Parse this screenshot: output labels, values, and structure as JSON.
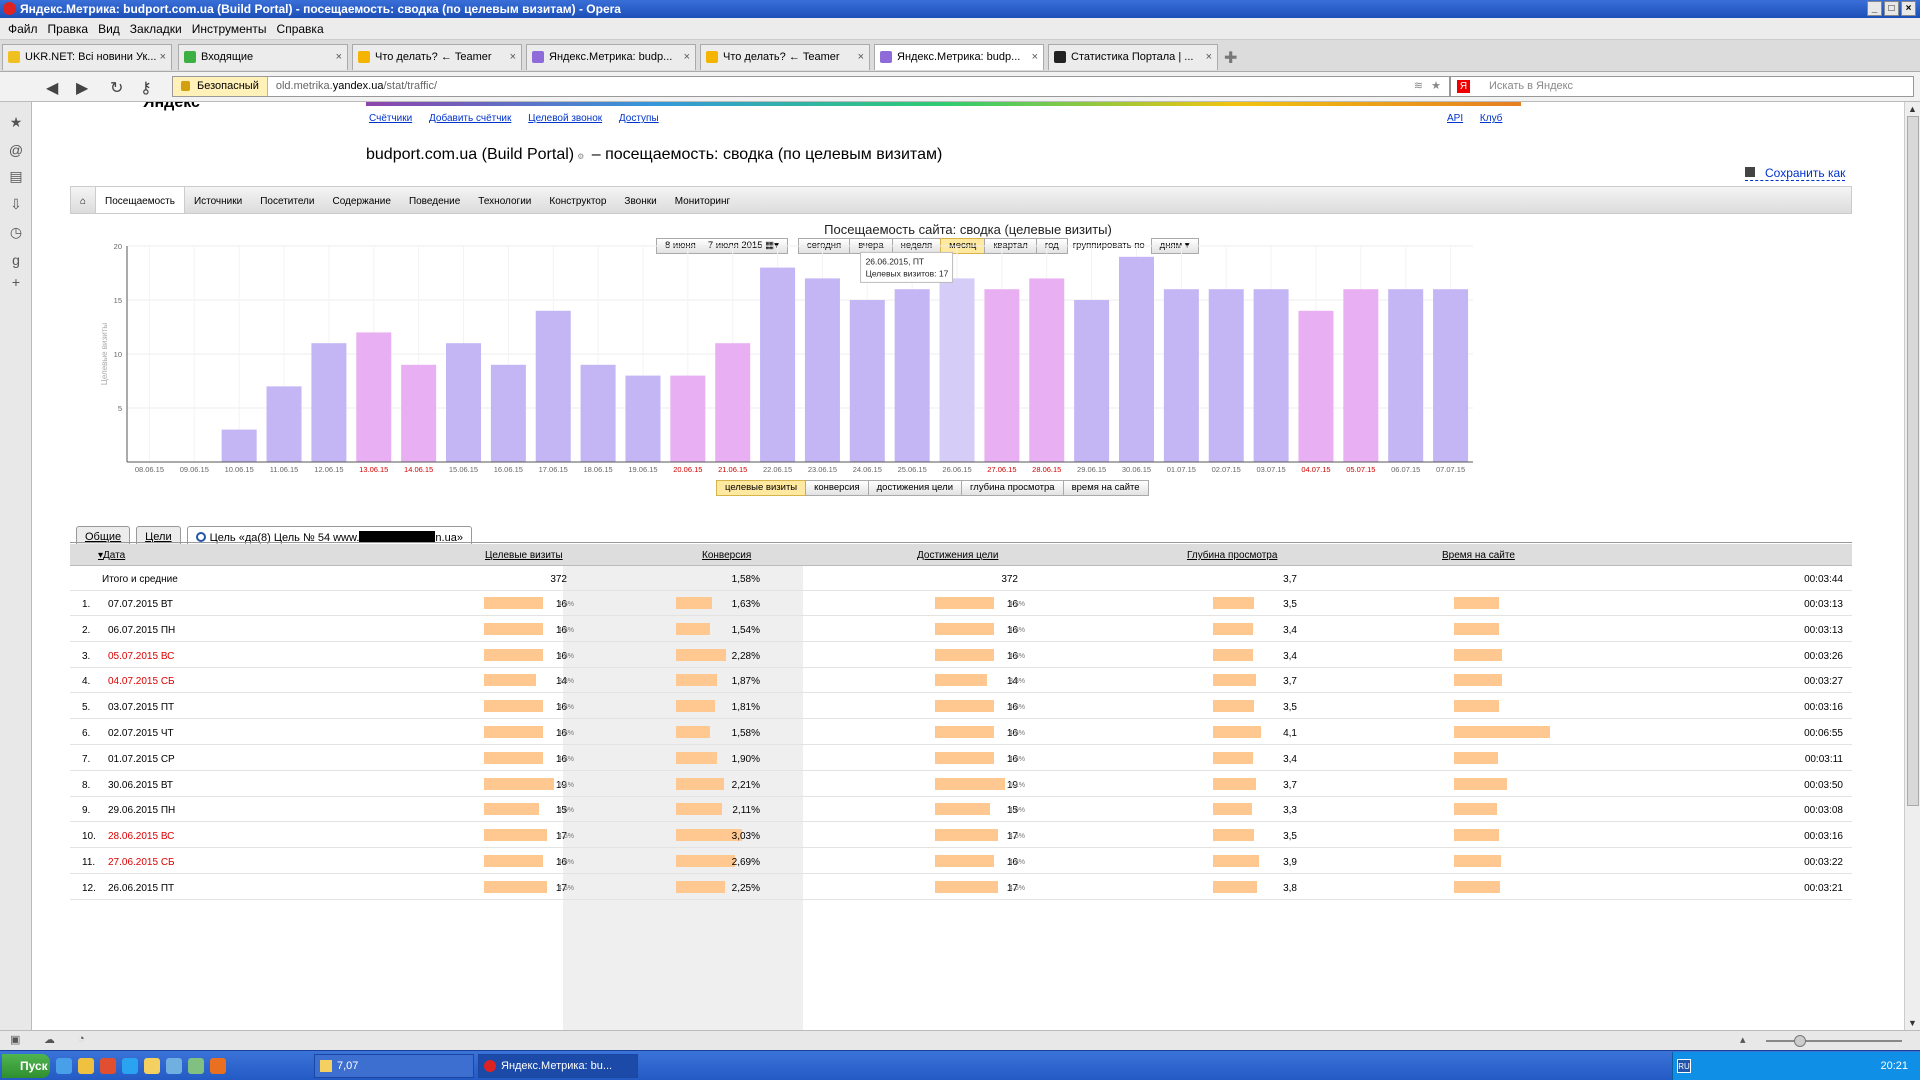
{
  "window": {
    "title": "Яндекс.Метрика: budport.com.ua (Build Portal) - посещаемость: сводка (по целевым визитам) - Opera"
  },
  "menu": [
    "Файл",
    "Правка",
    "Вид",
    "Закладки",
    "Инструменты",
    "Справка"
  ],
  "tabs": [
    {
      "label": "UKR.NET: Всі новини Ук...",
      "color": "#f0c020"
    },
    {
      "label": "Входящие",
      "color": "#3cb043"
    },
    {
      "label": "Что делать? ← Teamer",
      "color": "#f5b400"
    },
    {
      "label": "Яндекс.Метрика: budp...",
      "color": "#8e6bd8"
    },
    {
      "label": "Что делать? ← Teamer",
      "color": "#f5b400"
    },
    {
      "label": "Яндекс.Метрика: budp...",
      "color": "#8e6bd8"
    },
    {
      "label": "Статистика Портала | ...",
      "color": "#222222"
    }
  ],
  "address": {
    "secure_label": "Безопасный",
    "url_prefix": "old.metrika.",
    "url_host": "yandex.ua",
    "url_path": "/stat/traffic/",
    "search_placeholder": "Искать в Яндекс"
  },
  "site": {
    "logo": "Яндекс",
    "links": [
      "Счётчики",
      "Добавить счётчик",
      "Целевой звонок",
      "Доступы"
    ],
    "right_links": [
      "API",
      "Клуб"
    ],
    "title_site": "budport.com.ua (Build Portal)",
    "title_rest": " – посещаемость: сводка (по целевым визитам)",
    "save_label": "Сохранить как",
    "nav": [
      "Посещаемость",
      "Источники",
      "Посетители",
      "Содержание",
      "Поведение",
      "Технологии",
      "Конструктор",
      "Звонки",
      "Мониторинг"
    ],
    "date_range": "8 июня —7 июля 2015",
    "periods": [
      "сегодня",
      "вчера",
      "неделя",
      "месяц",
      "квартал",
      "год"
    ],
    "period_selected": "месяц",
    "group_label": "группировать по",
    "group_value": "дням",
    "metric_tabs": [
      "целевые визиты",
      "конверсия",
      "достижения цели",
      "глубина просмотра",
      "время на сайте"
    ],
    "metric_selected": "целевые визиты",
    "table_tabs": [
      "Общие",
      "Цели"
    ],
    "goal_tab_prefix": "Цель «да(8) Цель № 54 www.",
    "goal_tab_suffix": "n.ua»"
  },
  "chart_data": {
    "type": "bar",
    "title": "Посещаемость сайта: сводка (целевые визиты)",
    "ylabel": "Целевые визиты",
    "ylim": [
      0,
      20
    ],
    "yticks": [
      5,
      10,
      15,
      20
    ],
    "categories": [
      "08.06.15",
      "09.06.15",
      "10.06.15",
      "11.06.15",
      "12.06.15",
      "13.06.15",
      "14.06.15",
      "15.06.15",
      "16.06.15",
      "17.06.15",
      "18.06.15",
      "19.06.15",
      "20.06.15",
      "21.06.15",
      "22.06.15",
      "23.06.15",
      "24.06.15",
      "25.06.15",
      "26.06.15",
      "27.06.15",
      "28.06.15",
      "29.06.15",
      "30.06.15",
      "01.07.15",
      "02.07.15",
      "03.07.15",
      "04.07.15",
      "05.07.15",
      "06.07.15",
      "07.07.15"
    ],
    "values": [
      0,
      0,
      3,
      7,
      11,
      12,
      9,
      11,
      9,
      14,
      9,
      8,
      8,
      11,
      18,
      17,
      15,
      16,
      17,
      16,
      17,
      15,
      19,
      16,
      16,
      16,
      14,
      16,
      16,
      16
    ],
    "weekend": [
      false,
      false,
      false,
      false,
      false,
      true,
      true,
      false,
      false,
      false,
      false,
      false,
      true,
      true,
      false,
      false,
      false,
      false,
      false,
      true,
      true,
      false,
      false,
      false,
      false,
      false,
      true,
      true,
      false,
      false
    ],
    "colors": {
      "weekday": "#c4b5f5",
      "weekend": "#e8b0f2",
      "hover": "#d6ccf8",
      "weekend_label": "#d00000"
    },
    "highlight_index": 18,
    "tooltip": {
      "date": "26.06.2015, ПТ",
      "text": "Целевых визитов: 17"
    }
  },
  "table": {
    "headers": [
      "Дата",
      "Целевые визиты",
      "Конверсия",
      "Достижения цели",
      "Глубина просмотра",
      "Время на сайте"
    ],
    "total": {
      "label": "Итого и средние",
      "visits": "372",
      "conv": "1,58%",
      "goals": "372",
      "depth": "3,7",
      "time": "00:03:44"
    },
    "rows": [
      {
        "n": "1.",
        "date": "07.07.2015 ВТ",
        "red": false,
        "visits": "16",
        "vp": "4,3%",
        "conv": "1,63%",
        "cv": 1.63,
        "goals": "16",
        "gp": "4,3%",
        "depth": "3,5",
        "dv": 3.5,
        "time": "00:03:13",
        "tv": 193
      },
      {
        "n": "2.",
        "date": "06.07.2015 ПН",
        "red": false,
        "visits": "16",
        "vp": "4,3%",
        "conv": "1,54%",
        "cv": 1.54,
        "goals": "16",
        "gp": "4,3%",
        "depth": "3,4",
        "dv": 3.4,
        "time": "00:03:13",
        "tv": 193
      },
      {
        "n": "3.",
        "date": "05.07.2015 ВС",
        "red": true,
        "visits": "16",
        "vp": "4,3%",
        "conv": "2,28%",
        "cv": 2.28,
        "goals": "16",
        "gp": "4,3%",
        "depth": "3,4",
        "dv": 3.4,
        "time": "00:03:26",
        "tv": 206
      },
      {
        "n": "4.",
        "date": "04.07.2015 СБ",
        "red": true,
        "visits": "14",
        "vp": "3,8%",
        "conv": "1,87%",
        "cv": 1.87,
        "goals": "14",
        "gp": "3,8%",
        "depth": "3,7",
        "dv": 3.7,
        "time": "00:03:27",
        "tv": 207
      },
      {
        "n": "5.",
        "date": "03.07.2015 ПТ",
        "red": false,
        "visits": "16",
        "vp": "4,3%",
        "conv": "1,81%",
        "cv": 1.81,
        "goals": "16",
        "gp": "4,3%",
        "depth": "3,5",
        "dv": 3.5,
        "time": "00:03:16",
        "tv": 196
      },
      {
        "n": "6.",
        "date": "02.07.2015 ЧТ",
        "red": false,
        "visits": "16",
        "vp": "4,3%",
        "conv": "1,58%",
        "cv": 1.58,
        "goals": "16",
        "gp": "4,3%",
        "depth": "4,1",
        "dv": 4.1,
        "time": "00:06:55",
        "tv": 415
      },
      {
        "n": "7.",
        "date": "01.07.2015 СР",
        "red": false,
        "visits": "16",
        "vp": "4,3%",
        "conv": "1,90%",
        "cv": 1.9,
        "goals": "16",
        "gp": "4,3%",
        "depth": "3,4",
        "dv": 3.4,
        "time": "00:03:11",
        "tv": 191
      },
      {
        "n": "8.",
        "date": "30.06.2015 ВТ",
        "red": false,
        "visits": "19",
        "vp": "5,1%",
        "conv": "2,21%",
        "cv": 2.21,
        "goals": "19",
        "gp": "5,1%",
        "depth": "3,7",
        "dv": 3.7,
        "time": "00:03:50",
        "tv": 230
      },
      {
        "n": "9.",
        "date": "29.06.2015 ПН",
        "red": false,
        "visits": "15",
        "vp": "4,0%",
        "conv": "2,11%",
        "cv": 2.11,
        "goals": "15",
        "gp": "4,0%",
        "depth": "3,3",
        "dv": 3.3,
        "time": "00:03:08",
        "tv": 188
      },
      {
        "n": "10.",
        "date": "28.06.2015 ВС",
        "red": true,
        "visits": "17",
        "vp": "4,6%",
        "conv": "3,03%",
        "cv": 3.03,
        "goals": "17",
        "gp": "4,6%",
        "depth": "3,5",
        "dv": 3.5,
        "time": "00:03:16",
        "tv": 196
      },
      {
        "n": "11.",
        "date": "27.06.2015 СБ",
        "red": true,
        "visits": "16",
        "vp": "4,3%",
        "conv": "2,69%",
        "cv": 2.69,
        "goals": "16",
        "gp": "4,3%",
        "depth": "3,9",
        "dv": 3.9,
        "time": "00:03:22",
        "tv": 202
      },
      {
        "n": "12.",
        "date": "26.06.2015 ПТ",
        "red": false,
        "visits": "17",
        "vp": "4,6%",
        "conv": "2,25%",
        "cv": 2.25,
        "goals": "17",
        "gp": "4,6%",
        "depth": "3,8",
        "dv": 3.8,
        "time": "00:03:21",
        "tv": 201
      }
    ]
  },
  "taskbar": {
    "start": "Пуск",
    "items": [
      "7,07",
      "Яндекс.Метрика: bu..."
    ],
    "lang": "RU",
    "time": "20:21"
  }
}
